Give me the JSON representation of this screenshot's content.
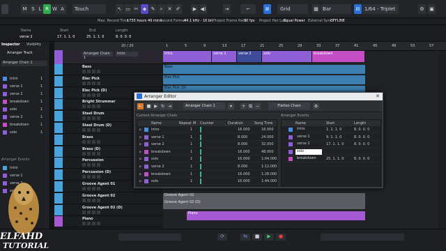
{
  "toolbar": {
    "mode": "Touch",
    "snap": "Grid",
    "quant": "Bar",
    "qvalue": "1/64 - Triplet",
    "letters": [
      "M",
      "S",
      "L",
      "R",
      "W",
      "A"
    ]
  },
  "infoline": [
    "Max. Record Time",
    "1755 hours 49 mins",
    "Record Format",
    "44.1 kHz - 16 bit",
    "Project Frame Rate",
    "30 fps",
    "Project Pan Law",
    "Equal Power",
    "External Sync",
    "OFFLINE"
  ],
  "posbar": {
    "name_lbl": "Name",
    "name_val": "verse 2",
    "start_lbl": "Start",
    "start_val": "17. 1. 1. 0",
    "end_lbl": "End",
    "end_val": "25. 1. 1. 0",
    "len_lbl": "Length",
    "len_val": "8. 0. 0. 0"
  },
  "inspector": {
    "tab1": "Inspector",
    "tab2": "Visibility",
    "section": "Arranger Track",
    "chain": "Arranger Chain 1",
    "events_lbl": "Arranger Events",
    "chain_items": [
      {
        "n": "intro",
        "v": "1"
      },
      {
        "n": "verse 1",
        "v": "1"
      },
      {
        "n": "verse 2",
        "v": "1"
      },
      {
        "n": "breakdown",
        "v": "1"
      },
      {
        "n": "solo",
        "v": "1"
      },
      {
        "n": "verse 2",
        "v": "1"
      },
      {
        "n": "breakdown",
        "v": "1"
      },
      {
        "n": "solo",
        "v": "1"
      }
    ],
    "event_items": [
      "intro",
      "verse 1",
      "verse 2",
      "solo"
    ]
  },
  "tracklist": {
    "arranger_chain": "Arranger Chain 1",
    "arranger_event": "intro",
    "counter": "20 / 20",
    "tracks": [
      {
        "name": "Bass",
        "color": "#4aa3df"
      },
      {
        "name": "Elec Pick",
        "color": "#4aa3df"
      },
      {
        "name": "Elec Pick (D)",
        "color": "#4aa3df"
      },
      {
        "name": "Bright Strummer",
        "color": "#4aa3df"
      },
      {
        "name": "Steel Drum",
        "color": "#4aa3df"
      },
      {
        "name": "Steel Drum (D)",
        "color": "#4aa3df"
      },
      {
        "name": "Brass",
        "color": "#4aa3df"
      },
      {
        "name": "Brass (D)",
        "color": "#4aa3df"
      },
      {
        "name": "Percussion",
        "color": "#4aa3df"
      },
      {
        "name": "Percussion (D)",
        "color": "#4aa3df"
      },
      {
        "name": "Groove Agent 01",
        "color": "#4aa3df"
      },
      {
        "name": "Groove Agent 02",
        "color": "#4aa3df"
      },
      {
        "name": "Groove Agent 02 (D)",
        "color": "#4aa3df"
      },
      {
        "name": "Piano",
        "color": "#a55ad4"
      }
    ]
  },
  "ruler": [
    "1",
    "5",
    "9",
    "13",
    "17",
    "21",
    "25",
    "29",
    "33",
    "37",
    "41",
    "45",
    "49",
    "53",
    "57"
  ],
  "arranger_clips": [
    "intro",
    "verse 1",
    "verse 2",
    "solo",
    "breakdown"
  ],
  "clips": {
    "bass": "Bass",
    "elec": "Elec Pick",
    "elecd": "Elec Pick (D)",
    "ga1": "Groove Agent 02",
    "ga2": "Groove Agent 02 (D)",
    "piano": "Piano"
  },
  "dialog": {
    "title": "Arranger Editor",
    "chain": "Arranger Chain 1",
    "flatten": "Flatten Chain",
    "left_title": "Current Arranger Chain",
    "right_title": "Arranger Events",
    "left_cols": [
      "Name",
      "Repeat",
      "M",
      "Counter",
      "Duration",
      "Song Time"
    ],
    "left_rows": [
      {
        "name": "intro",
        "rep": "1",
        "dur": "16.000",
        "time": "16.000",
        "color": "#4a90e2"
      },
      {
        "name": "verse 1",
        "rep": "1",
        "dur": "8.000",
        "time": "24.000",
        "color": "#8f5fd8"
      },
      {
        "name": "verse 2",
        "rep": "1",
        "dur": "8.000",
        "time": "32.000",
        "color": "#8f5fd8"
      },
      {
        "name": "breakdown",
        "rep": "1",
        "dur": "16.000",
        "time": "48.000",
        "color": "#c44ec4"
      },
      {
        "name": "solo",
        "rep": "1",
        "dur": "16.000",
        "time": "1:04.000",
        "color": "#8f5fd8"
      },
      {
        "name": "verse 2",
        "rep": "1",
        "dur": "8.000",
        "time": "1:12.000",
        "color": "#8f5fd8"
      },
      {
        "name": "breakdown",
        "rep": "1",
        "dur": "16.000",
        "time": "1:28.000",
        "color": "#c44ec4"
      },
      {
        "name": "solo",
        "rep": "1",
        "dur": "16.000",
        "time": "1:44.000",
        "color": "#8f5fd8"
      }
    ],
    "right_cols": [
      "Name",
      "Start",
      "Length"
    ],
    "right_rows": [
      {
        "name": "intro",
        "start": "1. 1. 1. 0",
        "len": "8. 0. 0. 0",
        "color": "#4a90e2"
      },
      {
        "name": "verse 1",
        "start": "9. 1. 1. 0",
        "len": "8. 0. 0. 0",
        "color": "#8f5fd8"
      },
      {
        "name": "verse 2",
        "start": "17. 1. 1. 0",
        "len": "8. 0. 0. 0",
        "color": "#8f5fd8"
      },
      {
        "name": "solo",
        "start": "",
        "len": "",
        "color": "#8f5fd8"
      },
      {
        "name": "breakdown",
        "start": "25. 1. 1. 0",
        "len": "8. 0. 0. 0",
        "color": "#c44ec4"
      }
    ]
  },
  "watermark": {
    "line1": "ELFAHD",
    "line2": "TUTORIAL"
  },
  "colors": {
    "arranger": "#8f5fd8",
    "audio": "#4aa3df",
    "magenta": "#c44ec4",
    "green": "#32c05a"
  }
}
